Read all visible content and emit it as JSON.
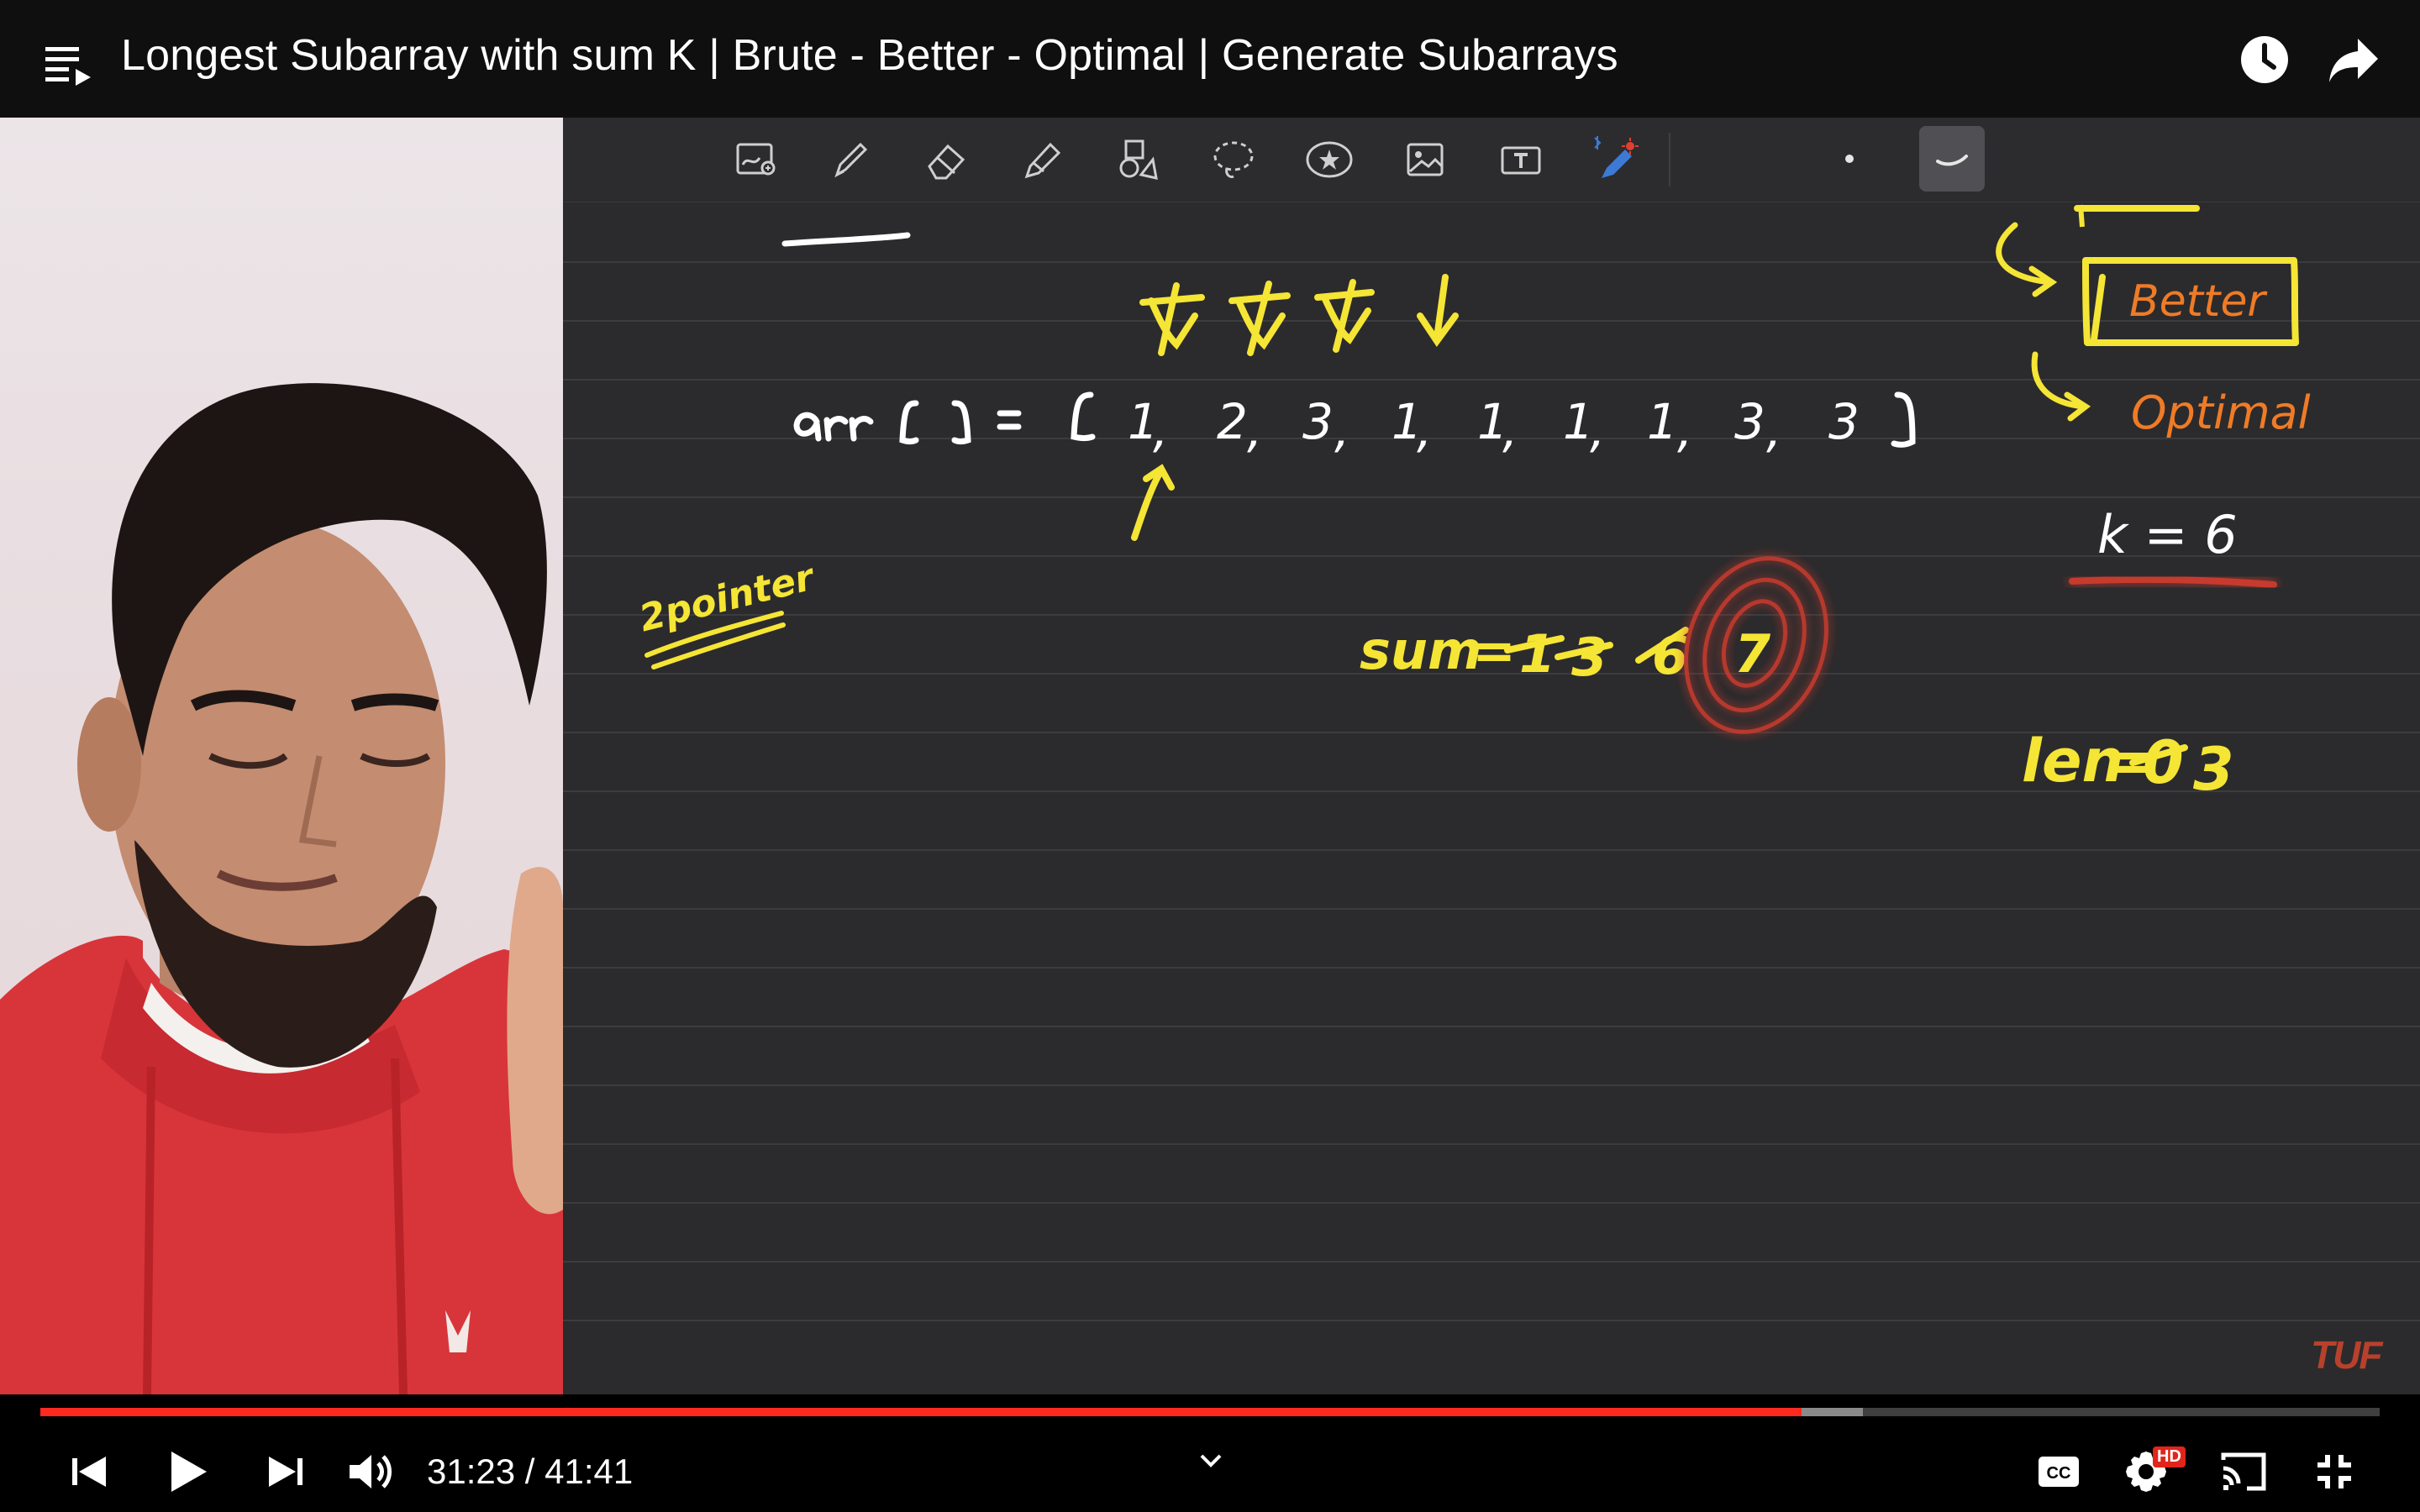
{
  "window": {
    "title": "Longest Subarray with sum K | Brute - Better - Optimal | Generate Subarrays"
  },
  "icons": {
    "playlist": "playlist-icon",
    "watch_later": "clock-icon",
    "share": "share-arrow-icon",
    "previous": "skip-previous-icon",
    "play": "play-icon",
    "next": "skip-next-icon",
    "volume": "volume-icon",
    "expand": "chevron-down-icon",
    "captions": "captions-icon",
    "settings": "gear-icon",
    "cast": "cast-icon",
    "exit_fullscreen": "exit-fullscreen-icon"
  },
  "toolbar": {
    "tools": [
      "zoom-window-tool",
      "pen-tool",
      "eraser-tool",
      "highlighter-tool",
      "shapes-tool",
      "lasso-tool",
      "elements-tool",
      "image-tool",
      "text-tool",
      "bluetooth-pencil-tool",
      "dot-separator",
      "stroke-width-tool"
    ],
    "selected": "stroke-width-tool"
  },
  "board": {
    "array_label": "arr[] =",
    "array_values": [
      "1",
      "2",
      "3",
      "1",
      "1",
      "1",
      "1",
      "3",
      "3"
    ],
    "sum_text": "sum = 1 3 6 7",
    "k_text": "k = 6",
    "len_text": "len = 0 3",
    "two_pointer_note": "2pointer",
    "better_label": "Better",
    "optimal_label": "Optimal",
    "watermark": "TUF"
  },
  "player": {
    "current_time": "31:23",
    "duration": "41:41",
    "time_display": "31:23 / 41:41",
    "progress_played": 0.753,
    "progress_buffered": 0.779,
    "hd_badge": "HD"
  },
  "colors": {
    "progress": "#ff2a1f",
    "ink_yellow": "#f5e535",
    "ink_orange": "#ef7b26",
    "ink_white": "#ffffff",
    "board_bg": "#2b2b2d"
  }
}
